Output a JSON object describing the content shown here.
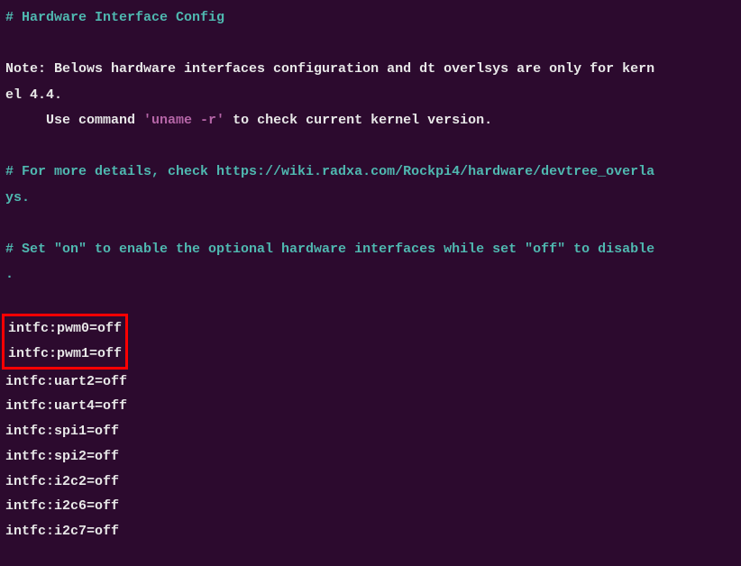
{
  "lines": {
    "l1": "# Hardware Interface Config",
    "l2a": "Note: Belows hardware interfaces configuration and dt overlsys are only for kern",
    "l2b": "el 4.4.",
    "l3a": "     Use command ",
    "l3b": "'uname -r'",
    "l3c": " to check current kernel version.",
    "l4a": "# For more details, check https://wiki.radxa.com/Rockpi4/hardware/devtree_overla",
    "l4b": "ys.",
    "l5a": "# Set \"on\" to enable the optional hardware interfaces while set \"off\" to disable",
    "l5b": "."
  },
  "intfc": {
    "pwm0": "intfc:pwm0=off",
    "pwm1": "intfc:pwm1=off",
    "uart2": "intfc:uart2=off",
    "uart4": "intfc:uart4=off",
    "spi1": "intfc:spi1=off",
    "spi2": "intfc:spi2=off",
    "i2c2": "intfc:i2c2=off",
    "i2c6": "intfc:i2c6=off",
    "i2c7": "intfc:i2c7=off"
  }
}
